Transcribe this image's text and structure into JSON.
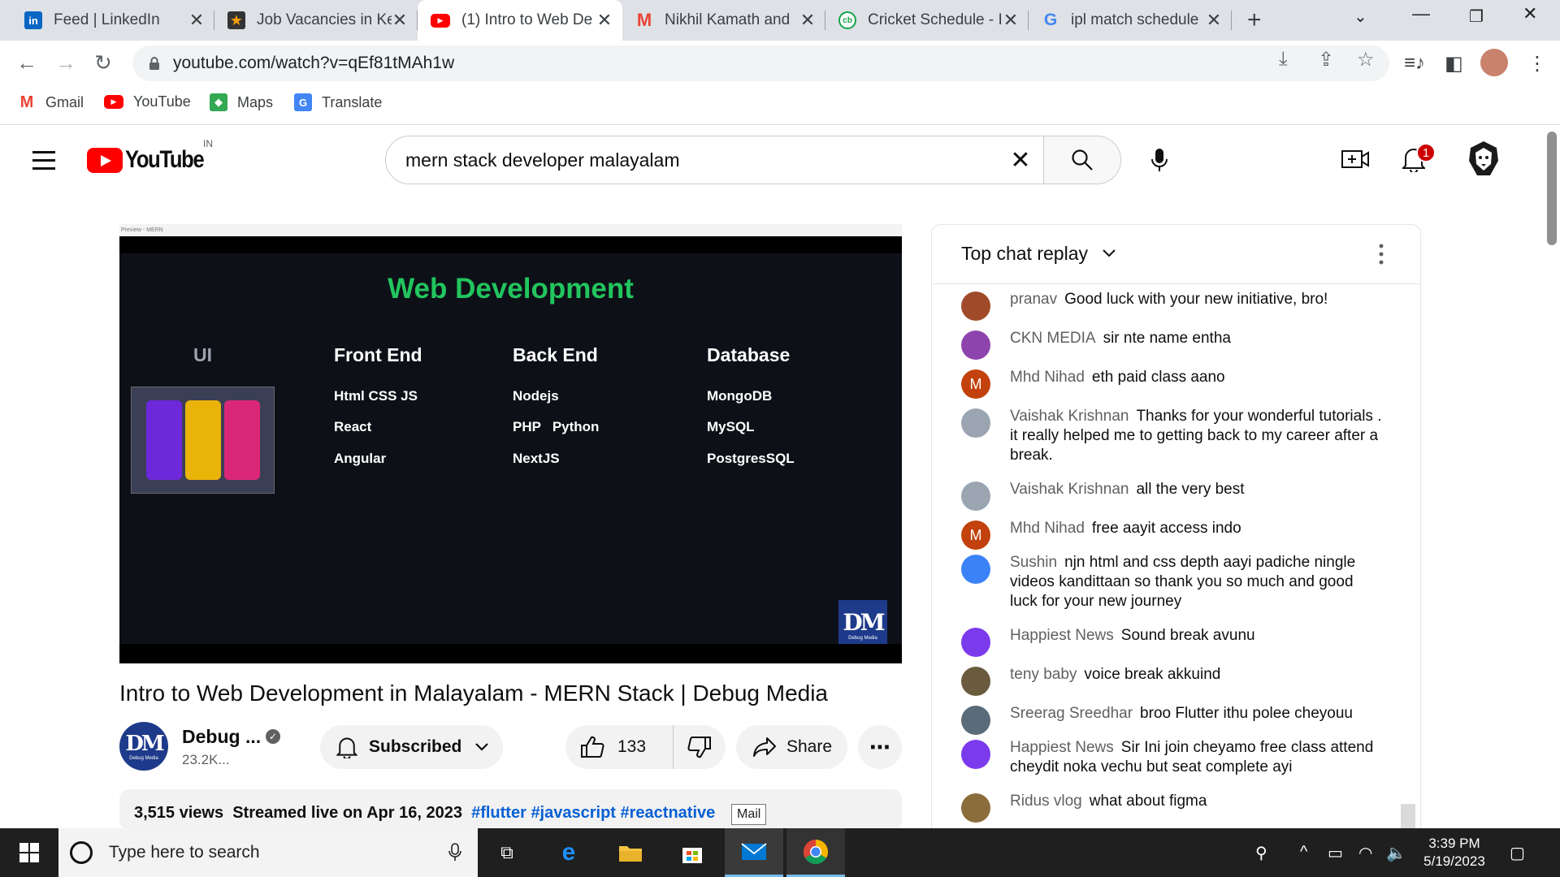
{
  "browser": {
    "tabs": [
      {
        "title": "Feed | LinkedIn",
        "icon": "linkedin-icon",
        "active": false
      },
      {
        "title": "Job Vacancies in Ke",
        "icon": "star-icon",
        "active": false
      },
      {
        "title": "(1) Intro to Web De",
        "icon": "youtube-icon",
        "active": true
      },
      {
        "title": "Nikhil Kamath and",
        "icon": "gmail-icon",
        "active": false
      },
      {
        "title": "Cricket Schedule - I",
        "icon": "cricbuzz-icon",
        "active": false
      },
      {
        "title": "ipl match schedule",
        "icon": "google-icon",
        "active": false
      }
    ],
    "url": "youtube.com/watch?v=qEf81tMAh1w",
    "bookmarks": [
      {
        "label": "Gmail"
      },
      {
        "label": "YouTube"
      },
      {
        "label": "Maps"
      },
      {
        "label": "Translate"
      }
    ]
  },
  "youtube": {
    "region": "IN",
    "search_query": "mern stack developer malayalam",
    "notification_count": "1",
    "video": {
      "slide": {
        "window_caption": "Preview - MERN",
        "title": "Web Development",
        "columns": [
          {
            "head": "UI",
            "items": []
          },
          {
            "head": "Front End",
            "items": [
              "Html CSS JS",
              "React",
              "Angular"
            ]
          },
          {
            "head": "Back End",
            "items": [
              "Nodejs",
              "PHP   Python",
              "NextJS"
            ]
          },
          {
            "head": "Database",
            "items": [
              "MongoDB",
              "MySQL",
              "PostgresSQL"
            ]
          }
        ],
        "watermark_big": "DM",
        "watermark_small": "Debug Media"
      },
      "title": "Intro to Web Development in Malayalam - MERN Stack | Debug Media",
      "channel_name": "Debug ...",
      "subscribers": "23.2K...",
      "subscribed_label": "Subscribed",
      "likes": "133",
      "share_label": "Share",
      "views": "3,515 views",
      "streamed": "Streamed live on Apr 16, 2023",
      "hashtags": [
        "#flutter",
        "#javascript",
        "#reactnative"
      ],
      "avatar_big": "DM",
      "avatar_small": "Debug Media"
    },
    "chat": {
      "header": "Top chat replay",
      "messages": [
        {
          "author": "pranav",
          "text": "Good luck with your new initiative, bro!",
          "avatar_color": "#a04a2a",
          "initial": ""
        },
        {
          "author": "CKN MEDIA",
          "text": "sir nte name entha",
          "avatar_color": "#8e44ad",
          "initial": ""
        },
        {
          "author": "Mhd Nihad",
          "text": "eth paid class aano",
          "avatar_color": "#c2410c",
          "initial": "M"
        },
        {
          "author": "Vaishak Krishnan",
          "text": "Thanks for your wonderful tutorials . it really helped me to getting back to my career after a break.",
          "avatar_color": "#9aa5b1",
          "initial": ""
        },
        {
          "author": "Vaishak Krishnan",
          "text": "all the very best",
          "avatar_color": "#9aa5b1",
          "initial": ""
        },
        {
          "author": "Mhd Nihad",
          "text": "free aayit access indo",
          "avatar_color": "#c2410c",
          "initial": "M"
        },
        {
          "author": "Sushin",
          "text": "njn html and css depth aayi padiche ningle videos kandittaan so thank you so much and good luck for your new journey",
          "avatar_color": "#3b82f6",
          "initial": ""
        },
        {
          "author": "Happiest News",
          "text": "Sound break avunu",
          "avatar_color": "#7c3aed",
          "initial": ""
        },
        {
          "author": "teny baby",
          "text": "voice break akkuind",
          "avatar_color": "#6b5b3e",
          "initial": ""
        },
        {
          "author": "Sreerag Sreedhar",
          "text": "broo Flutter ithu polee cheyouu",
          "avatar_color": "#5a6b7a",
          "initial": ""
        },
        {
          "author": "Happiest News",
          "text": "Sir Ini join cheyamo free class attend cheydit noka vechu but seat complete ayi",
          "avatar_color": "#7c3aed",
          "initial": ""
        },
        {
          "author": "Ridus vlog",
          "text": "what about figma",
          "avatar_color": "#8a6d3b",
          "initial": ""
        }
      ]
    }
  },
  "tooltip": "Mail",
  "taskbar": {
    "search_placeholder": "Type here to search",
    "time": "3:39 PM",
    "date": "5/19/2023"
  }
}
